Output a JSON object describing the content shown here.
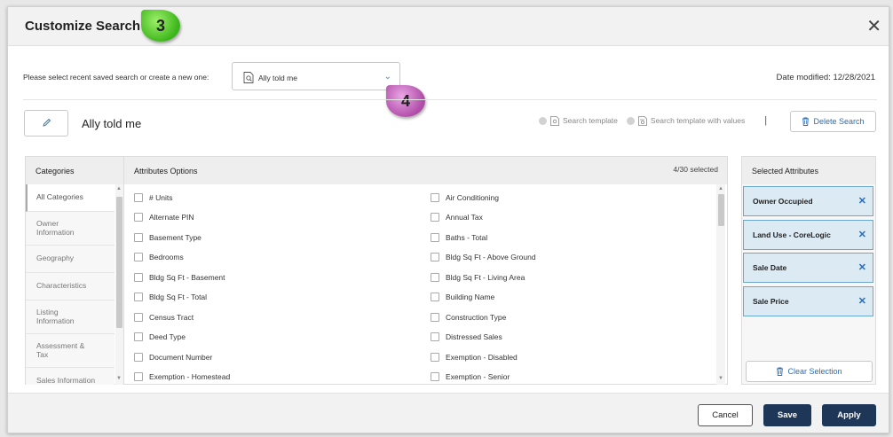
{
  "dialog": {
    "title": "Customize Search",
    "close_glyph": "✕",
    "annotations": [
      "3",
      "4"
    ]
  },
  "search_select": {
    "prompt": "Please select recent saved search or create a new one:",
    "selected_value": "Ally told me",
    "date_modified_label": "Date modified:",
    "date_modified_value": "12/28/2021"
  },
  "search_name": {
    "name": "Ally told me",
    "template_options": [
      "Search template",
      "Search template with values"
    ],
    "delete_label": "Delete Search"
  },
  "categories": {
    "header": "Categories",
    "items": [
      "All Categories",
      "Owner Information",
      "Geography",
      "Characteristics",
      "Listing Information",
      "Assessment & Tax",
      "Sales Information"
    ]
  },
  "attributes": {
    "header": "Attributes Options",
    "count_text": "4/30 selected",
    "left_column": [
      "# Units",
      "Alternate PIN",
      "Basement Type",
      "Bedrooms",
      "Bldg Sq Ft - Basement",
      "Bldg Sq Ft - Total",
      "Census Tract",
      "Deed Type",
      "Document Number",
      "Exemption - Homestead"
    ],
    "right_column": [
      "Air Conditioning",
      "Annual Tax",
      "Baths - Total",
      "Bldg Sq Ft - Above Ground",
      "Bldg Sq Ft - Living Area",
      "Building Name",
      "Construction Type",
      "Distressed Sales",
      "Exemption - Disabled",
      "Exemption - Senior"
    ]
  },
  "selected": {
    "header": "Selected Attributes",
    "items": [
      "Owner Occupied",
      "Land Use - CoreLogic",
      "Sale Date",
      "Sale Price"
    ],
    "clear_label": "Clear Selection"
  },
  "footer": {
    "cancel": "Cancel",
    "save": "Save",
    "apply": "Apply"
  },
  "colors": {
    "primary": "#1e3658",
    "link": "#2a6db5",
    "selected_bg": "#dceaf3",
    "badge_green": "#3bb51a",
    "badge_purple": "#b04ca8"
  }
}
